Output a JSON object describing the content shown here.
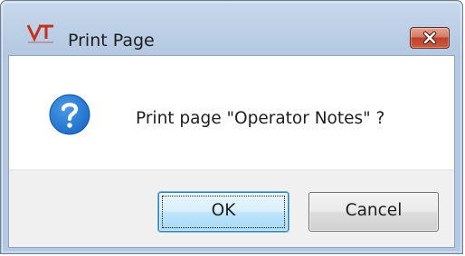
{
  "window": {
    "title": "Print Page",
    "logo_text": "VT",
    "icons": {
      "app_logo": "vt-logo-icon",
      "close": "close-icon",
      "question": "question-icon"
    }
  },
  "dialog": {
    "message": "Print page \"Operator Notes\" ?",
    "buttons": {
      "ok_label": "OK",
      "cancel_label": "Cancel"
    }
  },
  "colors": {
    "close_button": "#c1402a",
    "question_icon": "#1a6cc8",
    "logo": "#c8301e",
    "ok_border": "#3c7fb1"
  }
}
